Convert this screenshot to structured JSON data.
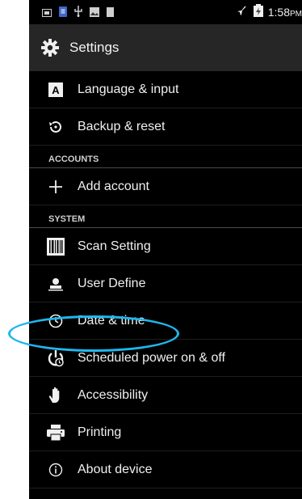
{
  "status_bar": {
    "time": "1:58",
    "time_suffix": "PM",
    "icons_left": [
      "notification-icon",
      "sim-icon",
      "usb-icon",
      "gallery-icon",
      "storage-icon"
    ],
    "icons_right": [
      "airplane-mode-icon",
      "battery-charging-icon"
    ]
  },
  "action_bar": {
    "title": "Settings",
    "icon": "gear-icon"
  },
  "items": [
    {
      "label": "Language & input",
      "icon": "language-icon"
    },
    {
      "label": "Backup & reset",
      "icon": "backup-icon"
    }
  ],
  "accounts_header": "ACCOUNTS",
  "accounts_items": [
    {
      "label": "Add account",
      "icon": "plus-icon"
    }
  ],
  "system_header": "SYSTEM",
  "system_items": [
    {
      "label": "Scan Setting",
      "icon": "barcode-icon"
    },
    {
      "label": "User Define",
      "icon": "user-icon"
    },
    {
      "label": "Date & time",
      "icon": "clock-icon"
    },
    {
      "label": "Scheduled power on & off",
      "icon": "power-clock-icon"
    },
    {
      "label": "Accessibility",
      "icon": "hand-icon"
    },
    {
      "label": "Printing",
      "icon": "printer-icon"
    },
    {
      "label": "About device",
      "icon": "info-icon"
    }
  ],
  "highlight": {
    "color": "#1fb7ee",
    "target": "Date & time"
  }
}
